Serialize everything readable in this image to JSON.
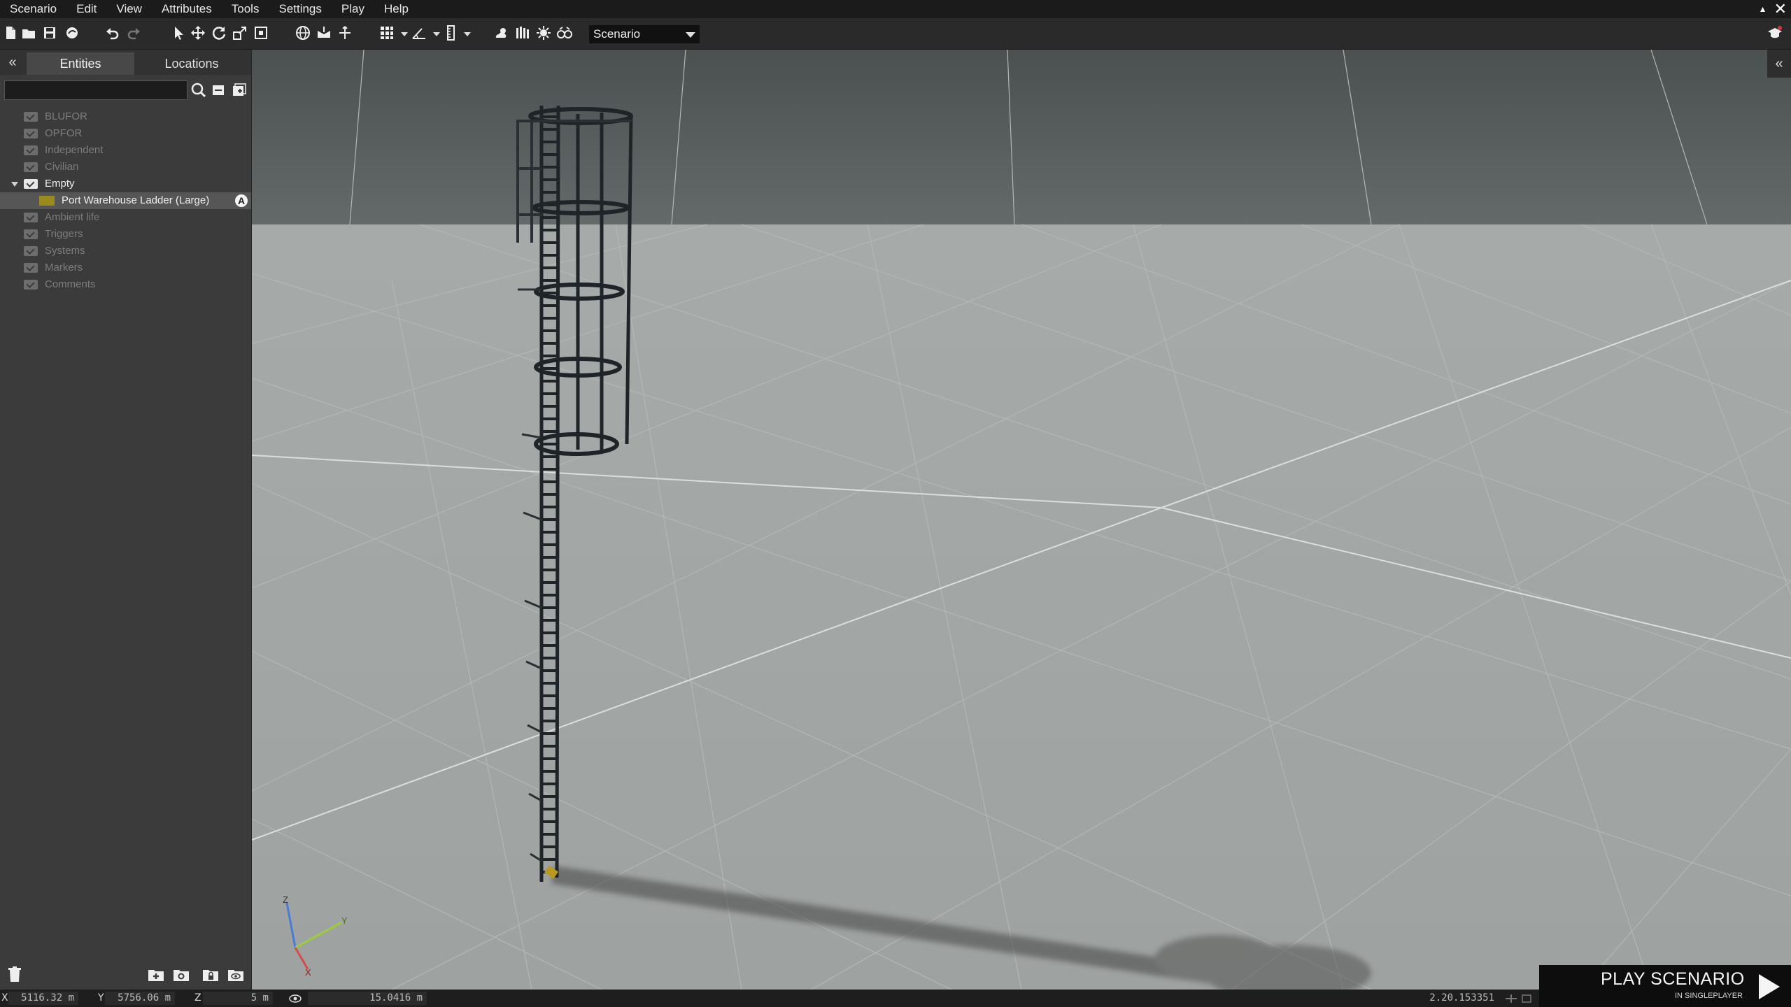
{
  "menu": {
    "items": [
      "Scenario",
      "Edit",
      "View",
      "Attributes",
      "Tools",
      "Settings",
      "Play",
      "Help"
    ]
  },
  "toolbar": {
    "scenario_select": "Scenario",
    "icons": [
      "new-file-icon",
      "open-folder-icon",
      "save-icon",
      "publish-icon",
      "undo-icon",
      "redo-icon",
      "select-icon",
      "move-icon",
      "rotate-icon",
      "scale-icon",
      "area-icon",
      "globe-icon",
      "vertical-mode-icon",
      "snap-surface-icon",
      "grid-icon",
      "angle-icon",
      "ruler-icon",
      "weather-icon",
      "environment-icon",
      "lighting-icon",
      "camera-icon"
    ]
  },
  "left_panel": {
    "collapse_label": "«",
    "tabs": [
      {
        "label": "Entities"
      },
      {
        "label": "Locations"
      }
    ],
    "search": {
      "placeholder": "",
      "value": ""
    },
    "tree": [
      {
        "label": "BLUFOR",
        "enabled": false
      },
      {
        "label": "OPFOR",
        "enabled": false
      },
      {
        "label": "Independent",
        "enabled": false
      },
      {
        "label": "Civilian",
        "enabled": false
      },
      {
        "label": "Empty",
        "enabled": true,
        "expanded": true,
        "children": [
          {
            "label": "Port Warehouse Ladder (Large)",
            "color": "#9a8a20",
            "badge": "A"
          }
        ]
      },
      {
        "label": "Ambient life",
        "enabled": false
      },
      {
        "label": "Triggers",
        "enabled": false
      },
      {
        "label": "Systems",
        "enabled": false
      },
      {
        "label": "Markers",
        "enabled": false
      },
      {
        "label": "Comments",
        "enabled": false
      }
    ]
  },
  "viewport": {
    "collapse_label": "«",
    "axes": {
      "z": "Z",
      "y": "Y",
      "x": "X"
    }
  },
  "statusbar": {
    "x_label": "X",
    "x_value": "5116.32 m",
    "y_label": "Y",
    "y_value": "5756.06 m",
    "z_label": "Z",
    "z_value": "5 m",
    "camera_value": "15.0416 m",
    "version": "2.20.153351"
  },
  "play_button": {
    "title": "PLAY SCENARIO",
    "subtitle": "IN SINGLEPLAYER"
  }
}
